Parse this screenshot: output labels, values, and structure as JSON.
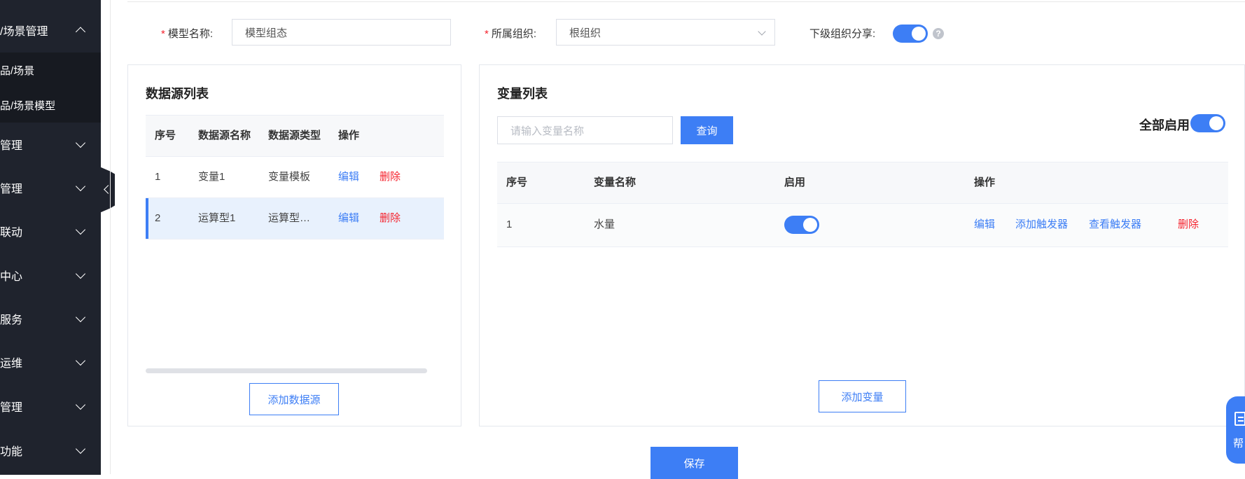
{
  "sidebar": {
    "expanded_item": {
      "label": "/场景管理",
      "icon": "chevron-up-icon"
    },
    "sub_items": [
      {
        "label": "品/场景"
      },
      {
        "label": "品/场景模型"
      }
    ],
    "items": [
      {
        "label": "管理",
        "icon": "chevron-down-icon"
      },
      {
        "label": "管理",
        "icon": "chevron-down-icon"
      },
      {
        "label": "联动",
        "icon": "chevron-down-icon"
      },
      {
        "label": "中心",
        "icon": "chevron-down-icon"
      },
      {
        "label": "服务",
        "icon": "chevron-down-icon"
      },
      {
        "label": "运维",
        "icon": "chevron-down-icon"
      },
      {
        "label": "管理",
        "icon": "chevron-down-icon"
      },
      {
        "label": "功能",
        "icon": "chevron-down-icon"
      }
    ],
    "collapse_icon": "chevron-left-icon",
    "background_color": "#1f232d"
  },
  "form": {
    "model_name_label": "模型名称:",
    "model_name_value": "模型组态",
    "org_label": "所属组织:",
    "org_value": "根组织",
    "share_label": "下级组织分享:",
    "share_enabled": true,
    "required_mark": "*"
  },
  "datasource_panel": {
    "title": "数据源列表",
    "columns": [
      "序号",
      "数据源名称",
      "数据源类型",
      "操作"
    ],
    "rows": [
      {
        "index": "1",
        "name": "变量1",
        "type": "变量模板",
        "edit": "编辑",
        "delete": "删除",
        "selected": false
      },
      {
        "index": "2",
        "name": "运算型1",
        "type": "运算型…",
        "edit": "编辑",
        "delete": "删除",
        "selected": true
      }
    ],
    "add_button": "添加数据源"
  },
  "variable_panel": {
    "title": "变量列表",
    "search_placeholder": "请输入变量名称",
    "search_button": "查询",
    "enable_all_label": "全部启用",
    "enable_all": true,
    "columns": [
      "序号",
      "变量名称",
      "启用",
      "操作"
    ],
    "rows": [
      {
        "index": "1",
        "name": "水量",
        "enabled": true,
        "edit": "编辑",
        "add_trigger": "添加触发器",
        "view_trigger": "查看触发器",
        "delete": "删除"
      }
    ],
    "add_button": "添加变量"
  },
  "save_button": "保存",
  "help_float": {
    "label": "帮",
    "icon": "document-icon"
  },
  "colors": {
    "accent": "#3d7ef5",
    "danger": "#f5222d"
  }
}
